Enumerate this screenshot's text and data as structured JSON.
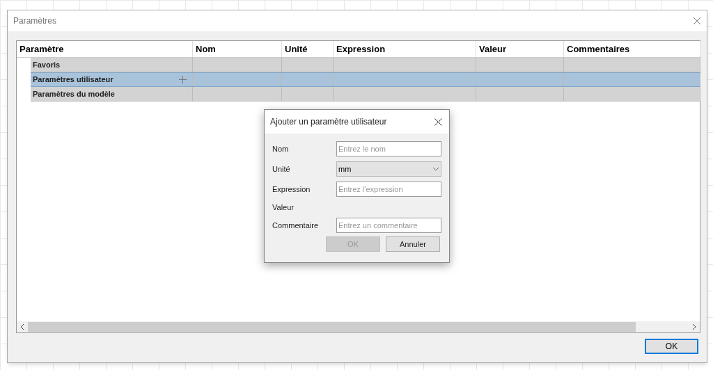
{
  "window": {
    "title": "Paramètres"
  },
  "table": {
    "columns": [
      "Paramètre",
      "Nom",
      "Unité",
      "Expression",
      "Valeur",
      "Commentaires"
    ],
    "rows": [
      {
        "label": "Favoris",
        "selected": false,
        "add_button": false
      },
      {
        "label": "Paramètres utilisateur",
        "selected": true,
        "add_button": true
      },
      {
        "label": "Paramètres du modèle",
        "selected": false,
        "add_button": false
      }
    ]
  },
  "buttons": [
    {
      "label": "OK"
    }
  ],
  "dialog": {
    "title": "Ajouter un paramètre utilisateur",
    "fields": [
      {
        "kind": "input",
        "label": "Nom",
        "placeholder": "Entrez le nom"
      },
      {
        "kind": "select",
        "label": "Unité",
        "value": "mm"
      },
      {
        "kind": "input",
        "label": "Expression",
        "placeholder": "Entrez l'expression"
      },
      {
        "kind": "readout",
        "label": "Valeur"
      },
      {
        "kind": "input",
        "label": "Commentaire",
        "placeholder": "Entrez un commentaire"
      }
    ],
    "buttons": [
      {
        "label": "OK",
        "disabled": true
      },
      {
        "label": "Annuler",
        "disabled": false
      }
    ]
  }
}
